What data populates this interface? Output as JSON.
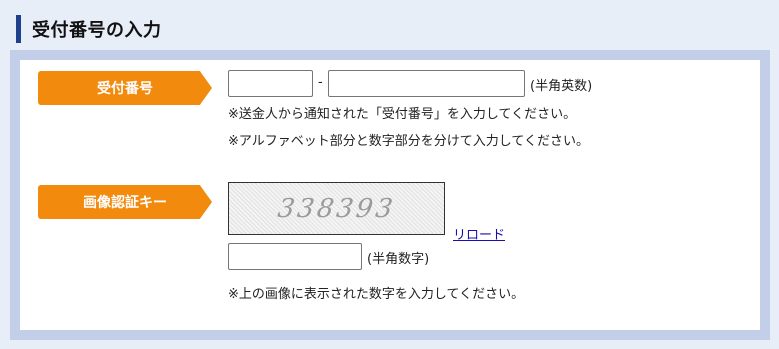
{
  "header": {
    "title": "受付番号の入力"
  },
  "section_receipt": {
    "label": "受付番号",
    "field_a_value": "",
    "field_b_value": "",
    "separator": "-",
    "format_hint": "(半角英数)",
    "note_1": "※送金人から通知された「受付番号」を入力してください。",
    "note_2": "※アルファベット部分と数字部分を分けて入力してください。"
  },
  "section_captcha": {
    "label": "画像認証キー",
    "captcha_text": "338393",
    "reload_label": "リロード",
    "field_value": "",
    "format_hint": "(半角数字)",
    "note": "※上の画像に表示された数字を入力してください。"
  },
  "colors": {
    "accent_orange": "#f28a0e",
    "header_bar": "#1f3f8f",
    "panel_border": "#c3cfe9",
    "page_bg": "#e8eef8",
    "link": "#1a0dab"
  }
}
